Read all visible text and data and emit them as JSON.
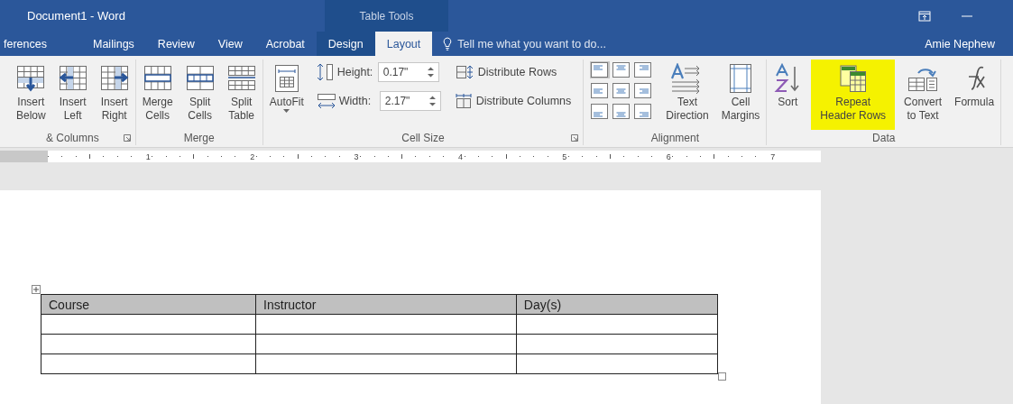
{
  "window": {
    "title": "Document1 - Word",
    "context_title": "Table Tools",
    "user": "Amie Nephew"
  },
  "tabs": [
    {
      "label": "ferences",
      "selected": false,
      "contextual": false
    },
    {
      "label": "Mailings",
      "selected": false,
      "contextual": false
    },
    {
      "label": "Review",
      "selected": false,
      "contextual": false
    },
    {
      "label": "View",
      "selected": false,
      "contextual": false
    },
    {
      "label": "Acrobat",
      "selected": false,
      "contextual": false
    },
    {
      "label": "Design",
      "selected": false,
      "contextual": true
    },
    {
      "label": "Layout",
      "selected": true,
      "contextual": true
    }
  ],
  "tell_me": {
    "placeholder": "Tell me what you want to do..."
  },
  "ribbon": {
    "groups": [
      {
        "label": "& Columns",
        "launcher": true,
        "columns": [
          {
            "items": [
              {
                "kind": "large",
                "lines": [
                  "Insert",
                  "Below"
                ]
              }
            ]
          },
          {
            "items": [
              {
                "kind": "large",
                "lines": [
                  "Insert",
                  "Left"
                ]
              }
            ]
          },
          {
            "items": [
              {
                "kind": "large",
                "lines": [
                  "Insert",
                  "Right"
                ]
              }
            ]
          }
        ]
      },
      {
        "label": "Merge",
        "launcher": false,
        "columns": [
          {
            "items": [
              {
                "kind": "large",
                "lines": [
                  "Merge",
                  "Cells"
                ]
              }
            ]
          },
          {
            "items": [
              {
                "kind": "large",
                "lines": [
                  "Split",
                  "Cells"
                ]
              }
            ]
          },
          {
            "items": [
              {
                "kind": "large",
                "lines": [
                  "Split",
                  "Table"
                ]
              }
            ]
          }
        ]
      },
      {
        "label": "Cell Size",
        "launcher": true,
        "columns": [
          {
            "items": [
              {
                "kind": "large",
                "lines": [
                  "AutoFit"
                ],
                "dropdown": true
              }
            ]
          },
          {
            "items": [
              {
                "kind": "spin",
                "label": "Height:",
                "value": "0.17\""
              },
              {
                "kind": "spin",
                "label": "Width:",
                "value": "2.17\""
              }
            ]
          },
          {
            "items": [
              {
                "kind": "small",
                "label": "Distribute Rows"
              },
              {
                "kind": "small",
                "label": "Distribute Columns"
              }
            ]
          }
        ]
      },
      {
        "label": "Alignment",
        "launcher": false,
        "columns": [
          {
            "items": [
              {
                "kind": "align-grid",
                "cells": [
                  {
                    "selected": true
                  },
                  {
                    "selected": false
                  },
                  {
                    "selected": false
                  },
                  {
                    "selected": false
                  },
                  {
                    "selected": false
                  },
                  {
                    "selected": false
                  },
                  {
                    "selected": false
                  },
                  {
                    "selected": false
                  },
                  {
                    "selected": false
                  }
                ]
              }
            ]
          },
          {
            "items": [
              {
                "kind": "large",
                "lines": [
                  "Text",
                  "Direction"
                ]
              }
            ]
          },
          {
            "items": [
              {
                "kind": "large",
                "lines": [
                  "Cell",
                  "Margins"
                ]
              }
            ]
          }
        ]
      },
      {
        "label": "Data",
        "launcher": false,
        "columns": [
          {
            "items": [
              {
                "kind": "large",
                "lines": [
                  "Sort"
                ]
              }
            ]
          },
          {
            "items": [
              {
                "kind": "large",
                "lines": [
                  "Repeat",
                  "Header Rows"
                ],
                "highlighted": true
              }
            ]
          },
          {
            "items": [
              {
                "kind": "large",
                "lines": [
                  "Convert",
                  "to Text"
                ]
              }
            ]
          },
          {
            "items": [
              {
                "kind": "large",
                "lines": [
                  "Formula"
                ]
              }
            ]
          }
        ]
      }
    ]
  },
  "ruler": {
    "numbers": [
      "1",
      "2",
      "3",
      "4",
      "5",
      "6",
      "7"
    ]
  },
  "table": {
    "columns": [
      "Course",
      "Instructor",
      "Day(s)"
    ],
    "rows": [
      [
        "",
        "",
        ""
      ],
      [
        "",
        "",
        ""
      ],
      [
        "",
        "",
        ""
      ]
    ]
  }
}
